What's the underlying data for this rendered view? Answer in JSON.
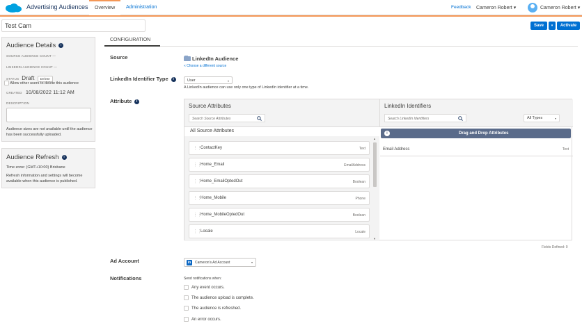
{
  "header": {
    "app_title": "Advertising Audiences",
    "tabs": [
      {
        "label": "Overview"
      },
      {
        "label": "Administration"
      }
    ],
    "feedback_label": "Feedback",
    "user_dropdown_label": "Cameron Robert ▾",
    "user_name_label": "Cameron Robert ▾"
  },
  "audience": {
    "name": "Test Cam",
    "save_label": "Save",
    "dropdown_caret": "▾",
    "activate_label": "Activate"
  },
  "details": {
    "title": "Audience Details",
    "source_count_label": "SOURCE AUDIENCE COUNT —",
    "linkedin_count_label": "LINKEDIN AUDIENCE COUNT —",
    "status_label": "STATUS",
    "status_value": "Draft",
    "delete_label": "Delete",
    "allow_delete_label": "Allow other users to delete this audience",
    "created_label": "CREATED",
    "created_value": "10/08/2022 11:12 AM",
    "description_label": "DESCRIPTION",
    "size_note": "Audience sizes are not available until the audience has been successfully uploaded."
  },
  "refresh": {
    "title": "Audience Refresh",
    "timezone": "Time zone: (GMT+10:00) Brisbane",
    "note": "Refresh information and settings will become available when this audience is published."
  },
  "config": {
    "tab_label": "CONFIGURATION",
    "source_label": "Source",
    "source_name": "LinkedIn Audience",
    "source_link": "« Choose a different source",
    "identifier_label": "LinkedIn Identifier Type",
    "identifier_value": "User",
    "identifier_note": "A LinkedIn audience can use only one type of LinkedIn identifier at a time.",
    "attribute_label": "Attribute",
    "source_attributes_title": "Source Attributes",
    "source_search_placeholder": "Search Source Attributes",
    "all_source_label": "All Source Attributes",
    "source_items": [
      {
        "name": "ContactKey",
        "type": "Text"
      },
      {
        "name": "Home_Email",
        "type": "EmailAddress"
      },
      {
        "name": "Home_EmailOptedOut",
        "type": "Boolean"
      },
      {
        "name": "Home_Mobile",
        "type": "Phone"
      },
      {
        "name": "Home_MobileOptedOut",
        "type": "Boolean"
      },
      {
        "name": "Locale",
        "type": "Locale"
      }
    ],
    "linkedin_identifiers_title": "LinkedIn Identifiers",
    "linkedin_search_placeholder": "Search LinkedIn Identifiers",
    "types_filter": "All Types",
    "drag_drop_label": "Drag and Drop Attributes",
    "identifier_rows": [
      {
        "name": "Email Address",
        "type": "Text"
      }
    ],
    "fields_defined": "Fields Defined: 0",
    "ad_account_label": "Ad Account",
    "ad_account_value": "Cameron's Ad Account",
    "notifications_label": "Notifications",
    "notifications_intro": "Send notifications when:",
    "notification_options": [
      "Any event occurs.",
      "The audience upload is complete.",
      "The audience is refreshed.",
      "An error occurs."
    ]
  }
}
